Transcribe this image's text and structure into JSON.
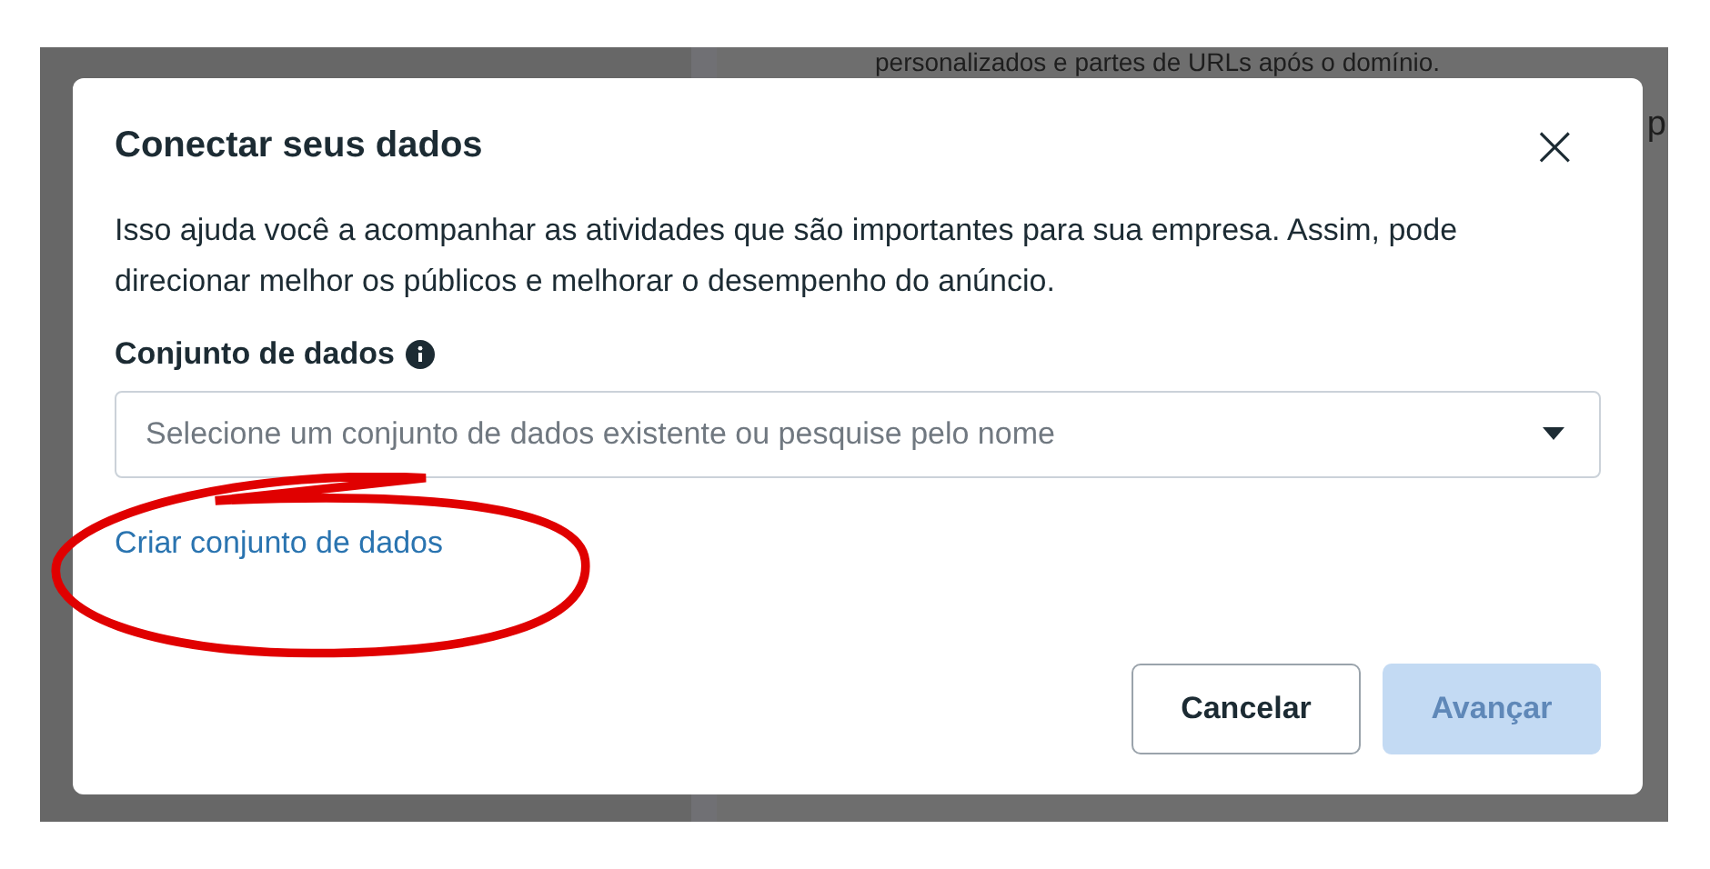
{
  "background": {
    "texts": [
      "personalizados e partes de URLs após o domínio.",
      "p"
    ]
  },
  "dialog": {
    "title": "Conectar seus dados",
    "close": "×",
    "description": "Isso ajuda você a acompanhar as atividades que são importantes para sua empresa. Assim, pode direcionar melhor os públicos e melhorar o desempenho do anúncio.",
    "field": {
      "label": "Conjunto de dados",
      "placeholder": "Selecione um conjunto de dados existente ou pesquise pelo nome"
    },
    "link": "Criar conjunto de dados",
    "buttons": [
      {
        "label": "Cancelar",
        "kind": "secondary",
        "disabled": false
      },
      {
        "label": "Avançar",
        "kind": "primary",
        "disabled": true
      }
    ]
  }
}
